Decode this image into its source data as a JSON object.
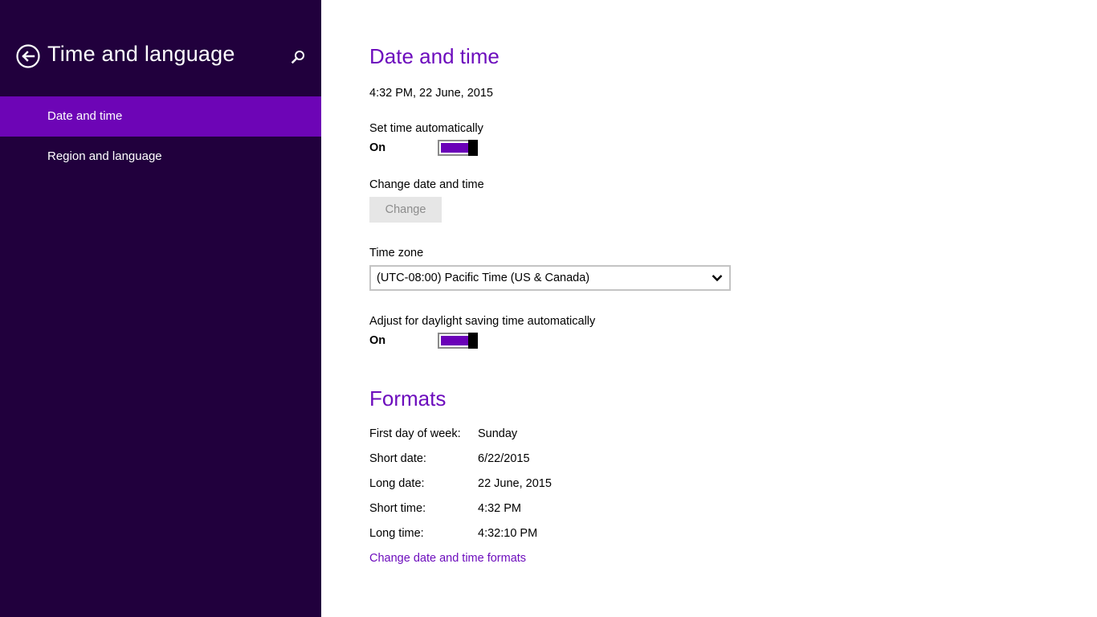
{
  "sidebar": {
    "title": "Time and language",
    "items": [
      {
        "label": "Date and time",
        "active": true
      },
      {
        "label": "Region and language",
        "active": false
      }
    ]
  },
  "icons": {
    "back": "back-arrow-icon",
    "search": "search-icon",
    "chevron": "chevron-down-icon"
  },
  "colors": {
    "sidebar_bg": "#21003d",
    "accent": "#6d05b6",
    "heading": "#6d0dbd"
  },
  "date_time": {
    "title": "Date and time",
    "current": "4:32 PM, 22 June, 2015",
    "set_auto_label": "Set time automatically",
    "set_auto_state": "On",
    "change_label": "Change date and time",
    "change_button": "Change",
    "timezone_label": "Time zone",
    "timezone_value": "(UTC-08:00) Pacific Time (US & Canada)",
    "dst_label": "Adjust for daylight saving time automatically",
    "dst_state": "On"
  },
  "formats": {
    "title": "Formats",
    "rows": [
      {
        "label": "First day of week:",
        "value": "Sunday"
      },
      {
        "label": "Short date:",
        "value": "6/22/2015"
      },
      {
        "label": "Long date:",
        "value": "22 June, 2015"
      },
      {
        "label": "Short time:",
        "value": "4:32 PM"
      },
      {
        "label": "Long time:",
        "value": "4:32:10 PM"
      }
    ],
    "change_link": "Change date and time formats"
  }
}
